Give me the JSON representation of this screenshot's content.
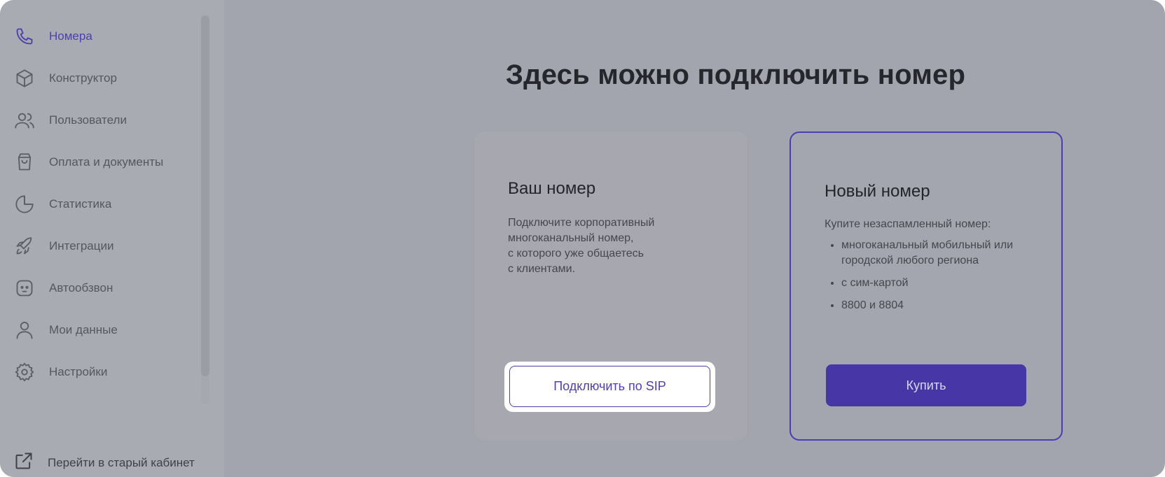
{
  "sidebar": {
    "items": [
      {
        "label": "Номера",
        "icon": "phone-icon",
        "active": true
      },
      {
        "label": "Конструктор",
        "icon": "cube-icon"
      },
      {
        "label": "Пользователи",
        "icon": "users-icon"
      },
      {
        "label": "Оплата и документы",
        "icon": "shopping-bag-icon"
      },
      {
        "label": "Статистика",
        "icon": "pie-chart-icon"
      },
      {
        "label": "Интеграции",
        "icon": "rocket-icon"
      },
      {
        "label": "Автообзвон",
        "icon": "robot-icon"
      },
      {
        "label": "Мои данные",
        "icon": "user-icon"
      },
      {
        "label": "Настройки",
        "icon": "gear-icon"
      }
    ],
    "bottom_link": {
      "label": "Перейти в старый кабинет",
      "icon": "external-link-icon"
    }
  },
  "main": {
    "title": "Здесь можно подключить номер",
    "own_card": {
      "title": "Ваш номер",
      "description": "Подключите корпоративный\nмногоканальный номер,\nс которого уже общаетесь\nс клиентами.",
      "button": "Подключить по SIP"
    },
    "new_card": {
      "title": "Новый номер",
      "intro": "Купите незаспамленный номер:",
      "bullets": [
        "многоканальный мобильный или городской любого региона",
        "с сим-картой",
        "8800 и 8804"
      ],
      "button": "Купить"
    }
  },
  "colors": {
    "accent": "#4e3fb0",
    "button_fill": "#4636a6",
    "overlay": "#a3a5ae"
  }
}
